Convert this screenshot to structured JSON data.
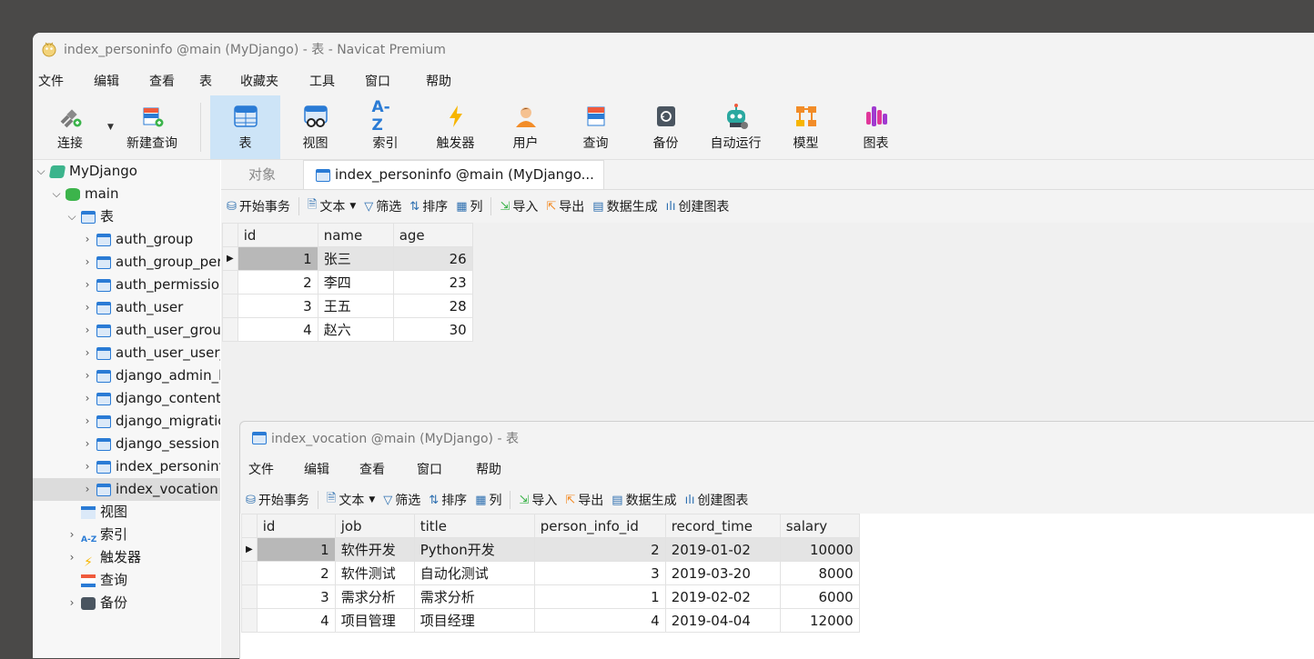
{
  "window": {
    "title": "index_personinfo @main (MyDjango) - 表 - Navicat Premium"
  },
  "menu": [
    "文件",
    "编辑",
    "查看",
    "表",
    "收藏夹",
    "工具",
    "窗口",
    "帮助"
  ],
  "toolbar": {
    "left": [
      {
        "label": "连接",
        "icon": "connect-icon"
      },
      {
        "label": "新建查询",
        "icon": "new-query-icon"
      }
    ],
    "right": [
      {
        "label": "表",
        "icon": "table-icon"
      },
      {
        "label": "视图",
        "icon": "view-icon"
      },
      {
        "label": "索引",
        "icon": "index-icon"
      },
      {
        "label": "触发器",
        "icon": "trigger-icon"
      },
      {
        "label": "用户",
        "icon": "user-icon"
      },
      {
        "label": "查询",
        "icon": "query-icon"
      },
      {
        "label": "备份",
        "icon": "backup-icon"
      },
      {
        "label": "自动运行",
        "icon": "automation-icon"
      },
      {
        "label": "模型",
        "icon": "model-icon"
      },
      {
        "label": "图表",
        "icon": "chart-icon"
      }
    ]
  },
  "sidebar": {
    "connection": "MyDjango",
    "database": "main",
    "tables_group": "表",
    "tables": [
      "auth_group",
      "auth_group_per",
      "auth_permissio",
      "auth_user",
      "auth_user_grou",
      "auth_user_user_",
      "django_admin_l",
      "django_content",
      "django_migratic",
      "django_session",
      "index_personint",
      "index_vocation"
    ],
    "other": [
      {
        "label": "视图"
      },
      {
        "label": "索引",
        "icon_text": "A-Z"
      },
      {
        "label": "触发器"
      },
      {
        "label": "查询"
      },
      {
        "label": "备份"
      }
    ]
  },
  "tabs": {
    "objects": "对象",
    "active": "index_personinfo @main (MyDjango..."
  },
  "subtoolbar": {
    "begin": "开始事务",
    "text": "文本",
    "filter": "筛选",
    "sort": "排序",
    "columns": "列",
    "import": "导入",
    "export": "导出",
    "datagen": "数据生成",
    "chart": "创建图表"
  },
  "grid1": {
    "columns": [
      "id",
      "name",
      "age"
    ],
    "rows": [
      [
        "1",
        "张三",
        "26"
      ],
      [
        "2",
        "李四",
        "23"
      ],
      [
        "3",
        "王五",
        "28"
      ],
      [
        "4",
        "赵六",
        "30"
      ]
    ]
  },
  "window2": {
    "title": "index_vocation @main (MyDjango) - 表",
    "menu": [
      "文件",
      "编辑",
      "查看",
      "窗口",
      "帮助"
    ],
    "columns": [
      "id",
      "job",
      "title",
      "person_info_id",
      "record_time",
      "salary"
    ],
    "rows": [
      [
        "1",
        "软件开发",
        "Python开发",
        "2",
        "2019-01-02",
        "10000"
      ],
      [
        "2",
        "软件测试",
        "自动化测试",
        "3",
        "2019-03-20",
        "8000"
      ],
      [
        "3",
        "需求分析",
        "需求分析",
        "1",
        "2019-02-02",
        "6000"
      ],
      [
        "4",
        "项目管理",
        "项目经理",
        "4",
        "2019-04-04",
        "12000"
      ]
    ]
  }
}
